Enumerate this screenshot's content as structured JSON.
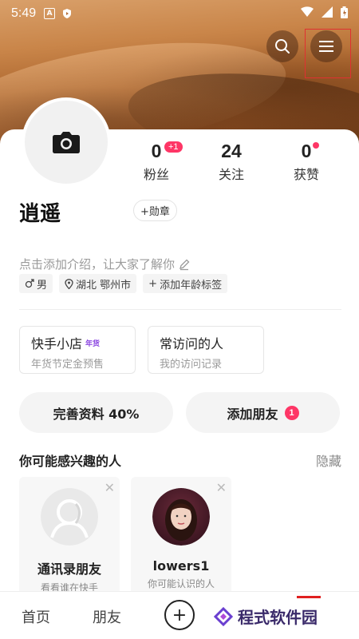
{
  "status_bar": {
    "time": "5:49",
    "icon_a": "A"
  },
  "profile": {
    "username": "逍遥",
    "medal_label": "+勋章",
    "intro_placeholder": "点击添加介绍，让大家了解你",
    "tags": {
      "gender": "男",
      "location": "湖北 鄂州市",
      "add_age": "添加年龄标签"
    }
  },
  "stats": {
    "fans": {
      "value": "0",
      "label": "粉丝",
      "badge": "+1"
    },
    "following": {
      "value": "24",
      "label": "关注"
    },
    "likes": {
      "value": "0",
      "label": "获赞"
    }
  },
  "shortcuts": {
    "shop": {
      "title": "快手小店",
      "tag": "年货",
      "subtitle": "年货节定金预售"
    },
    "visitors": {
      "title": "常访问的人",
      "subtitle": "我的访问记录"
    }
  },
  "actions": {
    "complete_profile": "完善资料 40%",
    "add_friends": "添加朋友",
    "add_friends_count": "1"
  },
  "recommendations": {
    "title": "你可能感兴趣的人",
    "hide_label": "隐藏",
    "items": [
      {
        "name": "通讯录朋友",
        "subtitle": "看看谁在快手"
      },
      {
        "name": "lowers1",
        "subtitle": "你可能认识的人"
      }
    ]
  },
  "bottom_nav": {
    "home": "首页",
    "friends": "朋友",
    "add": "+"
  },
  "watermark": "程式软件园",
  "colors": {
    "accent": "#fe3666",
    "highlight": "#e03131",
    "shop_tag": "#8a45e0"
  }
}
